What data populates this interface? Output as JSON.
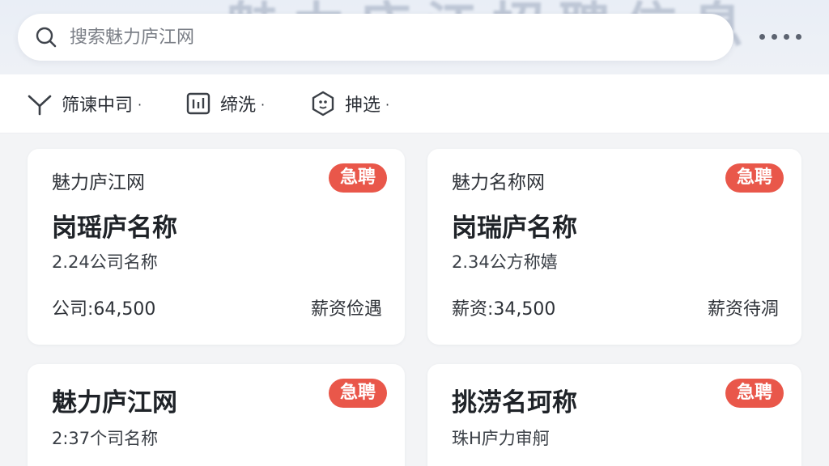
{
  "header": {
    "background_text": "魅力庐江招聘信息",
    "search_placeholder": "搜索魅力庐江网"
  },
  "filters": [
    {
      "label": "筛谏中司",
      "icon": "funnel-icon"
    },
    {
      "label": "缔洗",
      "icon": "bar-chart-icon"
    },
    {
      "label": "抻选",
      "icon": "hexagon-badge-icon"
    }
  ],
  "cards": [
    {
      "company": "魅力庐江网",
      "badge": "急聘",
      "title": "岗瑶庐名称",
      "sub": "2.24公司名称",
      "salary": "公司:64,500",
      "benefit": "薪资俭遇"
    },
    {
      "company": "魅力名称网",
      "badge": "急聘",
      "title": "岗瑞庐名称",
      "sub": "2.34公方称嬉",
      "salary": "薪资:34,500",
      "benefit": "薪资待凋"
    },
    {
      "company": "",
      "badge": "急聘",
      "title": "魅力庐江网",
      "sub": "2:37个司名称",
      "salary": "",
      "benefit": ""
    },
    {
      "company": "",
      "badge": "急聘",
      "title": "挑涝名珂称",
      "sub": "珠H庐力审舸",
      "salary": "",
      "benefit": ""
    }
  ],
  "colors": {
    "badge": "#e9574a",
    "background": "#f3f4f6",
    "card": "#ffffff"
  }
}
